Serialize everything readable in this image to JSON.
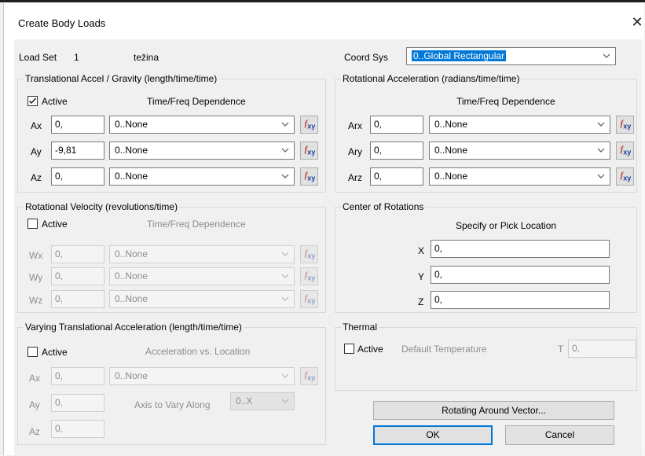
{
  "title": "Create Body Loads",
  "load_set": {
    "label": "Load Set",
    "number": "1",
    "name": "težina"
  },
  "coord_sys": {
    "label": "Coord Sys",
    "value": "0..Global Rectangular"
  },
  "trans_accel": {
    "title": "Translational Accel / Gravity  (length/time/time)",
    "active_label": "Active",
    "active_checked": true,
    "dependence_header": "Time/Freq Dependence",
    "rows": [
      {
        "label": "Ax",
        "value": "0,",
        "dependence": "0..None"
      },
      {
        "label": "Ay",
        "value": "-9,81",
        "dependence": "0..None"
      },
      {
        "label": "Az",
        "value": "0,",
        "dependence": "0..None"
      }
    ]
  },
  "rot_accel": {
    "title": "Rotational Acceleration (radians/time/time)",
    "dependence_header": "Time/Freq Dependence",
    "rows": [
      {
        "label": "Arx",
        "value": "0,",
        "dependence": "0..None"
      },
      {
        "label": "Ary",
        "value": "0,",
        "dependence": "0..None"
      },
      {
        "label": "Arz",
        "value": "0,",
        "dependence": "0..None"
      }
    ]
  },
  "rot_vel": {
    "title": "Rotational Velocity (revolutions/time)",
    "active_label": "Active",
    "active_checked": false,
    "dependence_header": "Time/Freq Dependence",
    "rows": [
      {
        "label": "Wx",
        "value": "0,",
        "dependence": "0..None"
      },
      {
        "label": "Wy",
        "value": "0,",
        "dependence": "0..None"
      },
      {
        "label": "Wz",
        "value": "0,",
        "dependence": "0..None"
      }
    ]
  },
  "center": {
    "title": "Center of Rotations",
    "header": "Specify or Pick Location",
    "rows": [
      {
        "label": "X",
        "value": "0,"
      },
      {
        "label": "Y",
        "value": "0,"
      },
      {
        "label": "Z",
        "value": "0,"
      }
    ]
  },
  "varying": {
    "title": "Varying Translational Acceleration  (length/time/time)",
    "active_label": "Active",
    "active_checked": false,
    "dependence_header": "Acceleration vs. Location",
    "axis_label": "Axis to Vary Along",
    "axis_value": "0..X",
    "rows": [
      {
        "label": "Ax",
        "value": "0,",
        "dependence": "0..None"
      },
      {
        "label": "Ay",
        "value": "0,"
      },
      {
        "label": "Az",
        "value": "0,"
      }
    ]
  },
  "thermal": {
    "title": "Thermal",
    "active_label": "Active",
    "active_checked": false,
    "default_temp_label": "Default Temperature",
    "t_label": "T",
    "t_value": "0,"
  },
  "buttons": {
    "rotating": "Rotating Around Vector...",
    "ok": "OK",
    "cancel": "Cancel"
  },
  "icons": {
    "function_icon": "fxy-function-icon",
    "dropdown": "chevron-down-icon",
    "close": "close-icon",
    "check": "checkmark-icon"
  },
  "colors": {
    "selection": "#0078d7",
    "icon_blue": "#1a3f9c",
    "icon_red": "#c0392b"
  }
}
